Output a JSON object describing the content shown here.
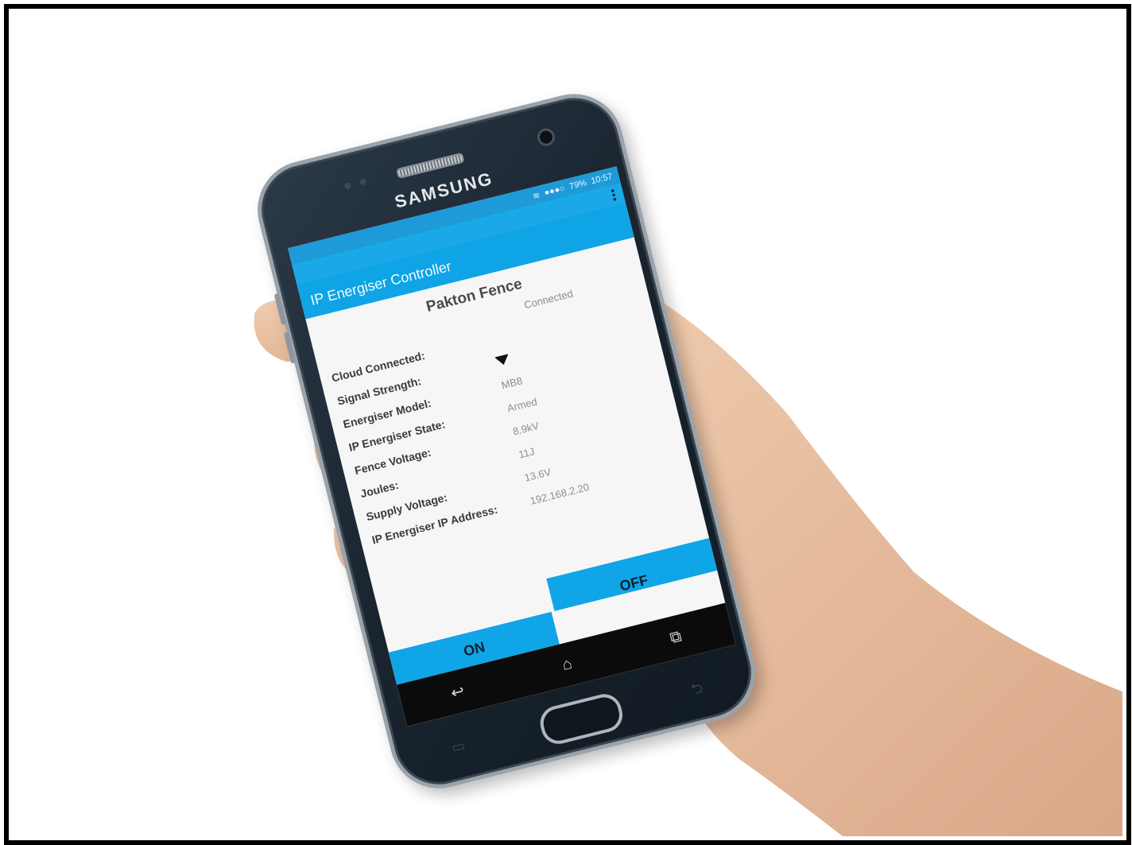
{
  "colors": {
    "appbar": "#0ea4e6",
    "statusbar": "#1e9ad8",
    "button": "#10a5e6",
    "phone_body": "#1a2530",
    "skin": "#e9c2a2"
  },
  "device": {
    "brand": "SAMSUNG"
  },
  "statusbar": {
    "wifi_icon": "wifi-icon",
    "signal": "●●●○",
    "battery": "79%",
    "time": "10:57"
  },
  "appbar": {
    "title": "IP Energiser Controller",
    "menu_icon": "more-vertical-icon"
  },
  "main": {
    "device_name": "Pakton Fence",
    "status": "Connected",
    "fields": [
      {
        "label": "Cloud Connected:",
        "value": ""
      },
      {
        "label": "Signal Strength:",
        "value": "",
        "icon": "wifi-signal-icon"
      },
      {
        "label": "Energiser Model:",
        "value": "MB8"
      },
      {
        "label": "IP Energiser State:",
        "value": "Armed"
      },
      {
        "label": "Fence Voltage:",
        "value": "8.9kV"
      },
      {
        "label": "Joules:",
        "value": "11J"
      },
      {
        "label": "Supply Voltage:",
        "value": "13.6V"
      },
      {
        "label": "IP Energiser IP Address:",
        "value": "192.168.2.20"
      }
    ]
  },
  "buttons": {
    "on": "ON",
    "off": "OFF"
  },
  "navbar": {
    "back_icon": "↩",
    "home_icon": "⌂",
    "recent_icon": "⧉"
  }
}
